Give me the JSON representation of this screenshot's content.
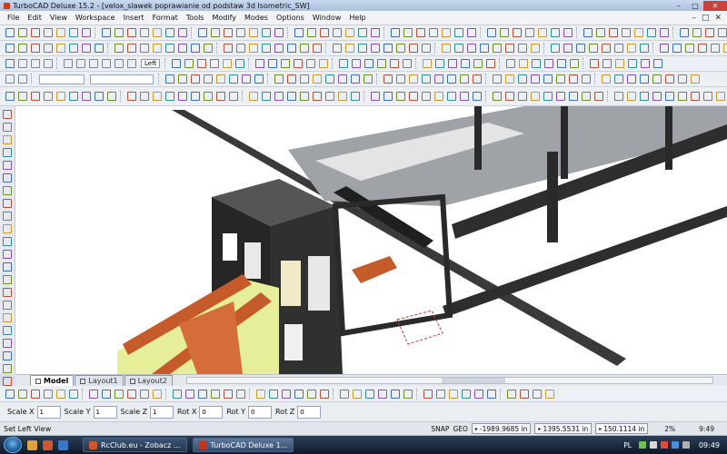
{
  "window": {
    "title": "TurboCAD Deluxe 15.2 - [velox_slawek poprawianie od podstaw 3d Isometric_SW]",
    "controls": [
      "–",
      "□",
      "✕"
    ]
  },
  "menu": {
    "items": [
      "File",
      "Edit",
      "View",
      "Workspace",
      "Insert",
      "Format",
      "Tools",
      "Modify",
      "Modes",
      "Options",
      "Window",
      "Help"
    ],
    "mdi_controls": [
      "–",
      "□",
      "✕"
    ]
  },
  "toolbar": {
    "view_label": "Left"
  },
  "tabs": [
    {
      "label": "Model",
      "active": true
    },
    {
      "label": "Layout1",
      "active": false
    },
    {
      "label": "Layout2",
      "active": false
    }
  ],
  "transform_fields": [
    {
      "label": "Scale X",
      "value": "1"
    },
    {
      "label": "Scale Y",
      "value": "1"
    },
    {
      "label": "Scale Z",
      "value": "1"
    },
    {
      "label": "Rot X",
      "value": "0"
    },
    {
      "label": "Rot Y",
      "value": "0"
    },
    {
      "label": "Rot Z",
      "value": "0"
    }
  ],
  "status": {
    "message": "Set Left View",
    "snap": "SNAP",
    "geo": "GEO",
    "coord_x": "-1989.9685 in",
    "coord_y": "1395.5531 in",
    "coord_z": "150.1114 in",
    "zoom": "2%",
    "time": "9:49"
  },
  "taskbar": {
    "buttons": [
      {
        "label": "RcClub.eu - Zobacz ...",
        "active": false
      },
      {
        "label": "TurboCAD Deluxe 1...",
        "active": true
      }
    ],
    "language": "PL",
    "clock": "09:49"
  },
  "colors": {
    "accent_close": "#c9433a",
    "frame_dark": "#2d2d2d",
    "orange_part": "#c55a2a",
    "yellow_part": "#e7ee9a"
  }
}
